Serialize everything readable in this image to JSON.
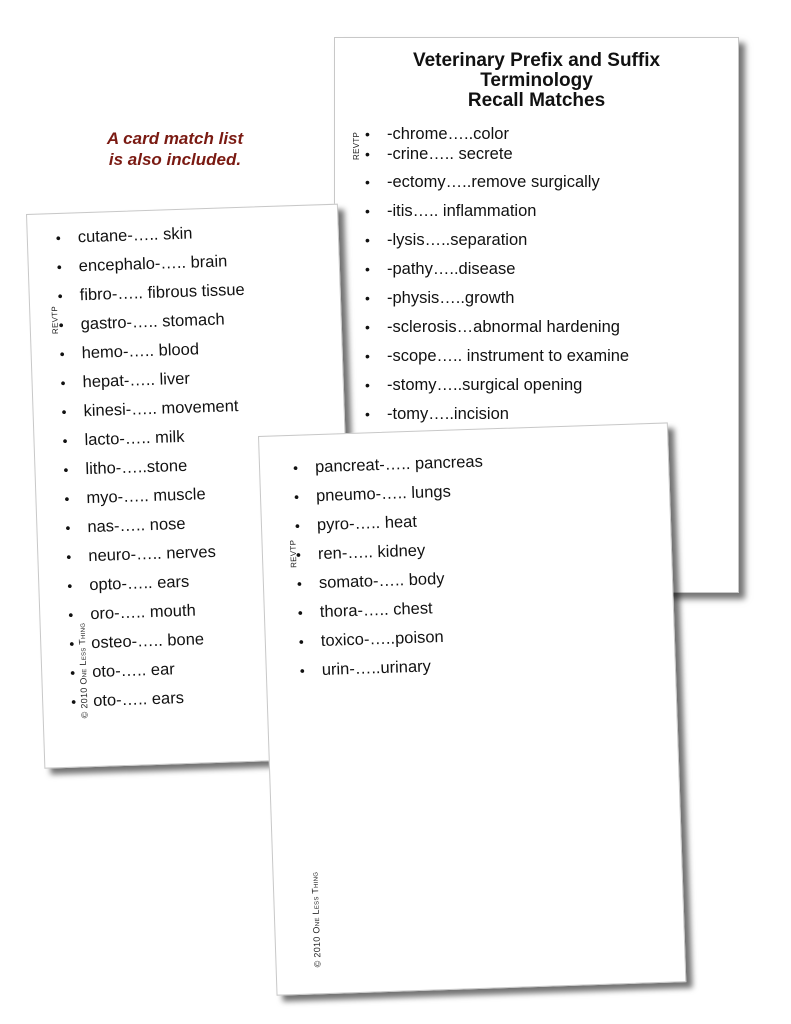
{
  "note": {
    "line1": "A card match list",
    "line2": "is also included.",
    "color": "#7a1a12"
  },
  "suffix_card": {
    "title_line1": "Veterinary Prefix and Suffix",
    "title_line2": "Terminology",
    "title_line3": "Recall Matches",
    "side_label": "REVTP",
    "items_top": [
      "-chrome…..color",
      "-crine….. secrete"
    ],
    "items": [
      "-ectomy…..remove surgically",
      "-itis….. inflammation",
      "-lysis…..separation",
      "-pathy…..disease",
      "-physis…..growth",
      "-sclerosis…abnormal hardening",
      "-scope….. instrument to examine",
      "-stomy…..surgical opening",
      "-tomy…..incision"
    ]
  },
  "prefix_card_a": {
    "side_label": "REVTP",
    "copyright": "© 2010 One Less Thing",
    "items": [
      "cutane-….. skin",
      "encephalo-….. brain",
      "fibro-….. fibrous tissue",
      "gastro-….. stomach",
      "hemo-….. blood",
      "hepat-….. liver",
      "kinesi-….. movement",
      "lacto-….. milk",
      "litho-…..stone",
      "myo-….. muscle",
      "nas-….. nose",
      "neuro-….. nerves",
      "opto-….. ears",
      "oro-….. mouth",
      "osteo-….. bone",
      "oto-….. ear",
      "oto-….. ears"
    ]
  },
  "prefix_card_b": {
    "side_label": "REVTP",
    "copyright": "© 2010 One Less Thing",
    "items": [
      "pancreat-….. pancreas",
      "pneumo-….. lungs",
      "pyro-….. heat",
      "ren-….. kidney",
      "somato-….. body",
      "thora-….. chest",
      "toxico-…..poison",
      "urin-…..urinary"
    ]
  },
  "bullet": "•"
}
